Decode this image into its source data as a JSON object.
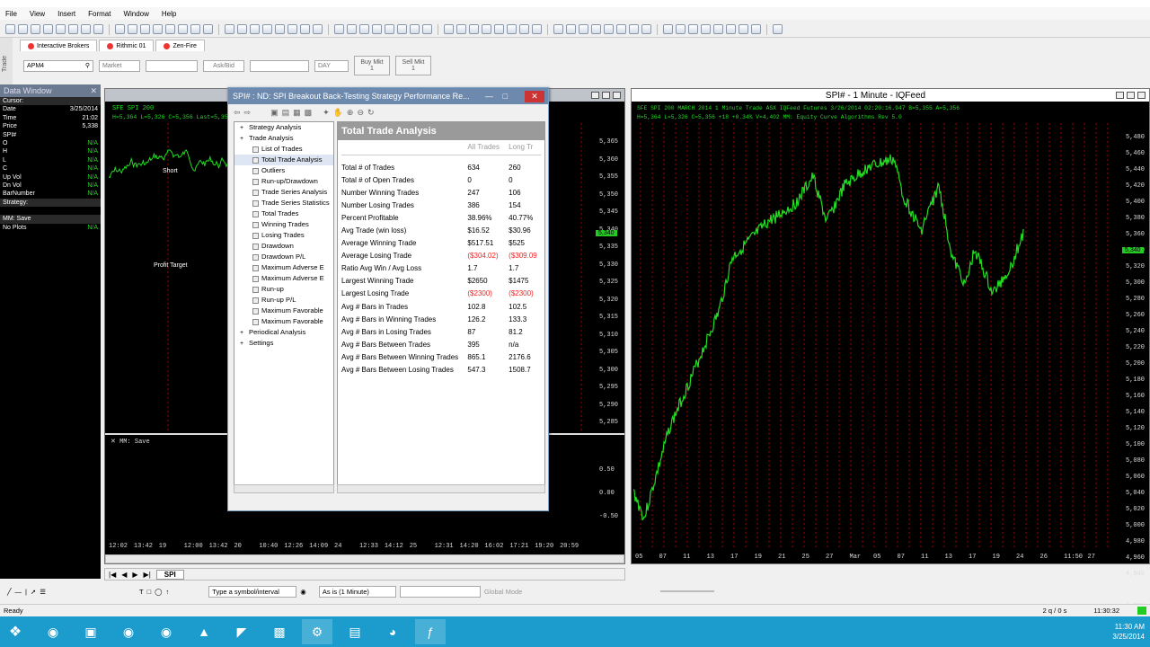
{
  "menu": [
    "File",
    "View",
    "Insert",
    "Format",
    "Window",
    "Help"
  ],
  "sidebar_label": "Trade",
  "order_tabs": [
    "Interactive Brokers",
    "Rithmic 01",
    "Zen-Fire"
  ],
  "order": {
    "symbol": "APM4",
    "type": "Market",
    "price_type": "Ask/Bid",
    "tif": "DAY",
    "buy_label": "Buy Mkt",
    "buy_qty": "1",
    "sell_label": "Sell Mkt",
    "sell_qty": "1"
  },
  "data_window": {
    "title": "Data Window",
    "rows": [
      {
        "k": "Cursor:",
        "v": ""
      },
      {
        "k": "Date",
        "v": "3/25/2014"
      },
      {
        "k": "Time",
        "v": "21:02"
      },
      {
        "k": "Price",
        "v": "5,338"
      },
      {
        "k": "SPI#",
        "v": ""
      },
      {
        "k": "O",
        "v": "N/A"
      },
      {
        "k": "H",
        "v": "N/A"
      },
      {
        "k": "L",
        "v": "N/A"
      },
      {
        "k": "C",
        "v": "N/A"
      },
      {
        "k": "Up Vol",
        "v": "N/A"
      },
      {
        "k": "Dn Vol",
        "v": "N/A"
      },
      {
        "k": "BarNumber",
        "v": "N/A"
      },
      {
        "k": "Strategy:",
        "v": ""
      },
      {
        "k": "",
        "v": ""
      },
      {
        "k": "MM: Save",
        "v": ""
      },
      {
        "k": "No Plots",
        "v": "N/A"
      }
    ]
  },
  "left_chart": {
    "header1": "SFE SPI 200",
    "header2": "H=5,364  L=5,326  C=5,356  Last=5,356",
    "labels": {
      "short": "Short",
      "profit": "Profit Target"
    },
    "price_ticks": [
      "5,365",
      "5,360",
      "5,355",
      "5,350",
      "5,345",
      "5,340",
      "5,335",
      "5,330",
      "5,325",
      "5,320",
      "5,315",
      "5,310",
      "5,305",
      "5,300",
      "5,295",
      "5,290",
      "5,285"
    ],
    "current_price": "5,340",
    "sub_title": "MM: Save",
    "sub_ticks": [
      "0.50",
      "0.00",
      "-0.50"
    ],
    "time_ticks": [
      "12:02",
      "13:42",
      "19",
      "12:00",
      "13:42",
      "20",
      "10:40",
      "12:26",
      "14:09",
      "24",
      "12:33",
      "14:12",
      "25",
      "12:31",
      "14:20",
      "16:02",
      "17:21",
      "19:20",
      "20:59"
    ],
    "tab": "SPI"
  },
  "right_chart": {
    "title": "SPI# - 1 Minute - IQFeed",
    "header1": "SFE SPI 200 MARCH 2014  1 Minute   Trade  ASX  IQFeed  Futures  3/26/2014  02:20:16.947  B=5,355  A=5,356",
    "header2": "H=5,364  L=5,326  C=5,356  +18  +0.34%  V=4,402  MM: Equity Curve Algorithms Rev 5.0",
    "price_ticks": [
      "5,480",
      "5,460",
      "5,440",
      "5,420",
      "5,400",
      "5,380",
      "5,360",
      "5,340",
      "5,320",
      "5,300",
      "5,280",
      "5,260",
      "5,240",
      "5,220",
      "5,200",
      "5,180",
      "5,160",
      "5,140",
      "5,120",
      "5,100",
      "5,080",
      "5,060",
      "5,040",
      "5,020",
      "5,000",
      "4,980",
      "4,960",
      "4,940",
      "4,920",
      "4,900"
    ],
    "current_price": "5,340",
    "date_ticks": [
      "05",
      "07",
      "11",
      "13",
      "17",
      "19",
      "21",
      "25",
      "27",
      "Mar",
      "05",
      "07",
      "11",
      "13",
      "17",
      "19",
      "24",
      "26",
      "11:50",
      "27"
    ]
  },
  "dialog": {
    "title": "SPI# : ND: SPI Breakout Back-Testing Strategy Performance Re...",
    "tree": [
      {
        "label": "Strategy Analysis",
        "level": 0
      },
      {
        "label": "Trade Analysis",
        "level": 0
      },
      {
        "label": "List of Trades",
        "level": 1
      },
      {
        "label": "Total Trade Analysis",
        "level": 1
      },
      {
        "label": "Outliers",
        "level": 1
      },
      {
        "label": "Run-up/Drawdown",
        "level": 1
      },
      {
        "label": "Trade Series Analysis",
        "level": 1
      },
      {
        "label": "Trade Series Statistics",
        "level": 1
      },
      {
        "label": "Total Trades",
        "level": 1
      },
      {
        "label": "Winning Trades",
        "level": 1
      },
      {
        "label": "Losing Trades",
        "level": 1
      },
      {
        "label": "Drawdown",
        "level": 1
      },
      {
        "label": "Drawdown P/L",
        "level": 1
      },
      {
        "label": "Maximum Adverse E",
        "level": 1
      },
      {
        "label": "Maximum Adverse E",
        "level": 1
      },
      {
        "label": "Run-up",
        "level": 1
      },
      {
        "label": "Run-up P/L",
        "level": 1
      },
      {
        "label": "Maximum Favorable",
        "level": 1
      },
      {
        "label": "Maximum Favorable",
        "level": 1
      },
      {
        "label": "Periodical Analysis",
        "level": 0
      },
      {
        "label": "Settings",
        "level": 0
      }
    ],
    "report_title": "Total Trade Analysis",
    "col_all": "All Trades",
    "col_long": "Long Tr",
    "rows": [
      {
        "l": "Total # of Trades",
        "a": "634",
        "b": "260"
      },
      {
        "l": "Total # of Open Trades",
        "a": "0",
        "b": "0"
      },
      {
        "l": "Number Winning Trades",
        "a": "247",
        "b": "106"
      },
      {
        "l": "Number Losing Trades",
        "a": "386",
        "b": "154"
      },
      {
        "l": "Percent Profitable",
        "a": "38.96%",
        "b": "40.77%"
      },
      {
        "l": "Avg Trade  (win  loss)",
        "a": "$16.52",
        "b": "$30.96"
      },
      {
        "l": "Average Winning Trade",
        "a": "$517.51",
        "b": "$525"
      },
      {
        "l": "Average Losing Trade",
        "a": "($304.02)",
        "b": "($309.09",
        "neg": true
      },
      {
        "l": "Ratio Avg Win / Avg Loss",
        "a": "1.7",
        "b": "1.7"
      },
      {
        "l": "Largest Winning Trade",
        "a": "$2650",
        "b": "$1475"
      },
      {
        "l": "Largest Losing Trade",
        "a": "($2300)",
        "b": "($2300)",
        "neg": true
      },
      {
        "l": "Avg # Bars in Trades",
        "a": "102.8",
        "b": "102.5"
      },
      {
        "l": "Avg # Bars in Winning Trades",
        "a": "126.2",
        "b": "133.3"
      },
      {
        "l": "Avg # Bars in Losing Trades",
        "a": "87",
        "b": "81.2"
      },
      {
        "l": "Avg # Bars Between Trades",
        "a": "395",
        "b": "n/a"
      },
      {
        "l": "Avg # Bars Between Winning Trades",
        "a": "865.1",
        "b": "2176.6"
      },
      {
        "l": "Avg # Bars Between Losing Trades",
        "a": "547.3",
        "b": "1508.7"
      }
    ]
  },
  "bottom_toolbar": {
    "symbol_placeholder": "Type a symbol/interval",
    "interval": "As is (1 Minute)",
    "mode": "Global Mode"
  },
  "status": {
    "ready": "Ready",
    "orders": "2 q / 0 s",
    "time": "11:30:32"
  },
  "taskbar": {
    "time": "11:30 AM",
    "date": "3/25/2014",
    "apps": [
      "start",
      "ie",
      "explorer",
      "dtn",
      "dtn",
      "app5",
      "app6",
      "app7",
      "app8",
      "app9",
      "chrome",
      "app11"
    ]
  },
  "colors": {
    "chart_bg": "#000000",
    "price_line": "#22dd22",
    "grid": "#aa0000",
    "dialog_title": "#6d89ad",
    "taskbar": "#1b9ccd"
  }
}
